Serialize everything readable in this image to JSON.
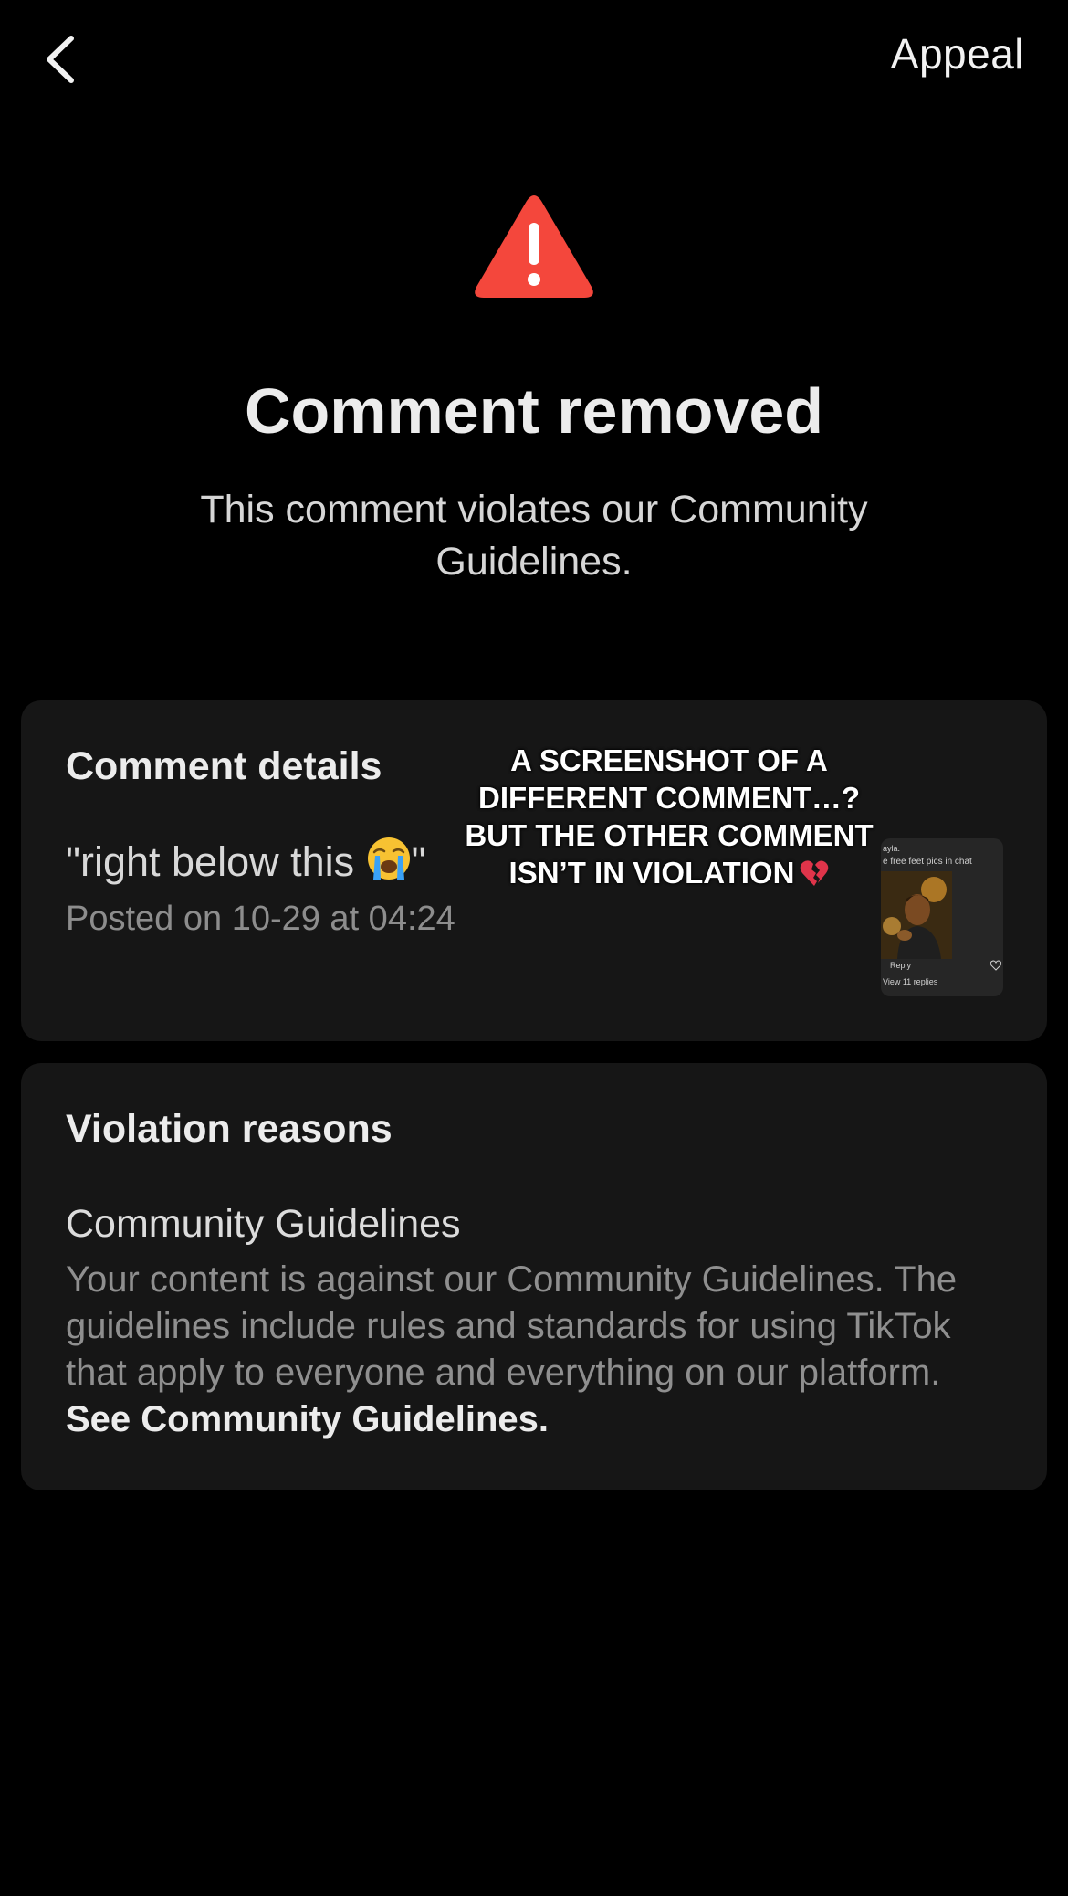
{
  "header": {
    "back_icon": "chevron-left-icon",
    "appeal_label": "Appeal"
  },
  "status": {
    "icon": "warning-triangle-icon",
    "icon_color": "#f4473c",
    "title": "Comment removed",
    "subtitle": "This comment violates our Community Guidelines."
  },
  "comment_details": {
    "heading": "Comment details",
    "comment_prefix": "\"right below this ",
    "comment_emoji": "loudly-crying-face-emoji",
    "comment_suffix": "\"",
    "posted": "Posted on 10-29 at 04:24",
    "overlay_caption": "A SCREENSHOT OF A DIFFERENT COMMENT…? BUT THE OTHER COMMENT ISN’T IN VIOLATION",
    "overlay_emoji": "broken-heart-emoji",
    "thumbnail": {
      "line1": "ayla.",
      "line2": "e free feet pics in chat",
      "reply": "Reply",
      "view_replies": "View 11 replies"
    }
  },
  "violation": {
    "heading": "Violation reasons",
    "guideline_title": "Community Guidelines",
    "guideline_body": "Your content is against our Community Guidelines. The guidelines include rules and standards for using TikTok that apply to everyone and everything on our platform. ",
    "guideline_link": "See Community Guidelines."
  }
}
